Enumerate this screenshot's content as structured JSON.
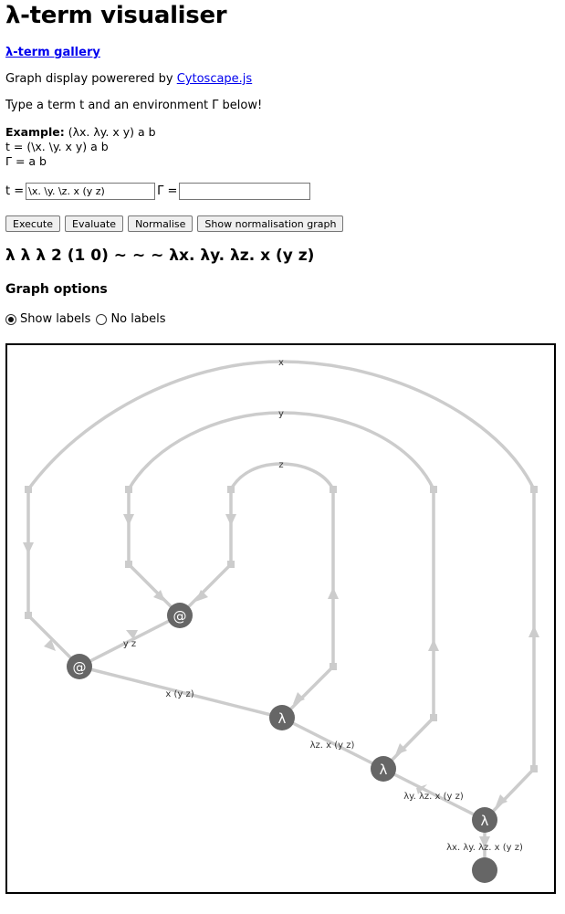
{
  "page": {
    "title": "λ-term visualiser",
    "gallery_link": "λ-term gallery",
    "powered_prefix": "Graph display powerered by ",
    "powered_link": "Cytoscape.js",
    "instructions": "Type a term t and an environment Γ below!",
    "example": {
      "label": "Example:",
      "term": " (λx. λy. x y) a b",
      "t_line": "t = (\\x. \\y. x y) a b",
      "env_line": "Γ = a b"
    }
  },
  "form": {
    "t_label": "t =",
    "t_value": "\\x. \\y. \\z. x (y z)",
    "env_label": "Γ =",
    "env_value": ""
  },
  "buttons": {
    "execute": "Execute",
    "evaluate": "Evaluate",
    "normalise": "Normalise",
    "show_graph": "Show normalisation graph"
  },
  "result": "λ λ λ 2 (1 0) ~ ~ ~ λx. λy. λz. x (y z)",
  "graph_options": {
    "heading": "Graph options",
    "show_labels": "Show labels",
    "no_labels": "No labels",
    "selected": "show_labels"
  },
  "graph": {
    "variables": [
      "x",
      "y",
      "z"
    ],
    "application_symbol": "@",
    "lambda_symbol": "λ",
    "edge_labels": {
      "app_inner": "y z",
      "app_outer": "x (y z)",
      "lam_z": "λz. x (y z)",
      "lam_y": "λy. λz. x (y z)",
      "lam_x": "λx. λy. λz. x (y z)"
    },
    "colors": {
      "edge": "#cccccc",
      "node": "#666666",
      "node_text": "#ffffff"
    }
  }
}
